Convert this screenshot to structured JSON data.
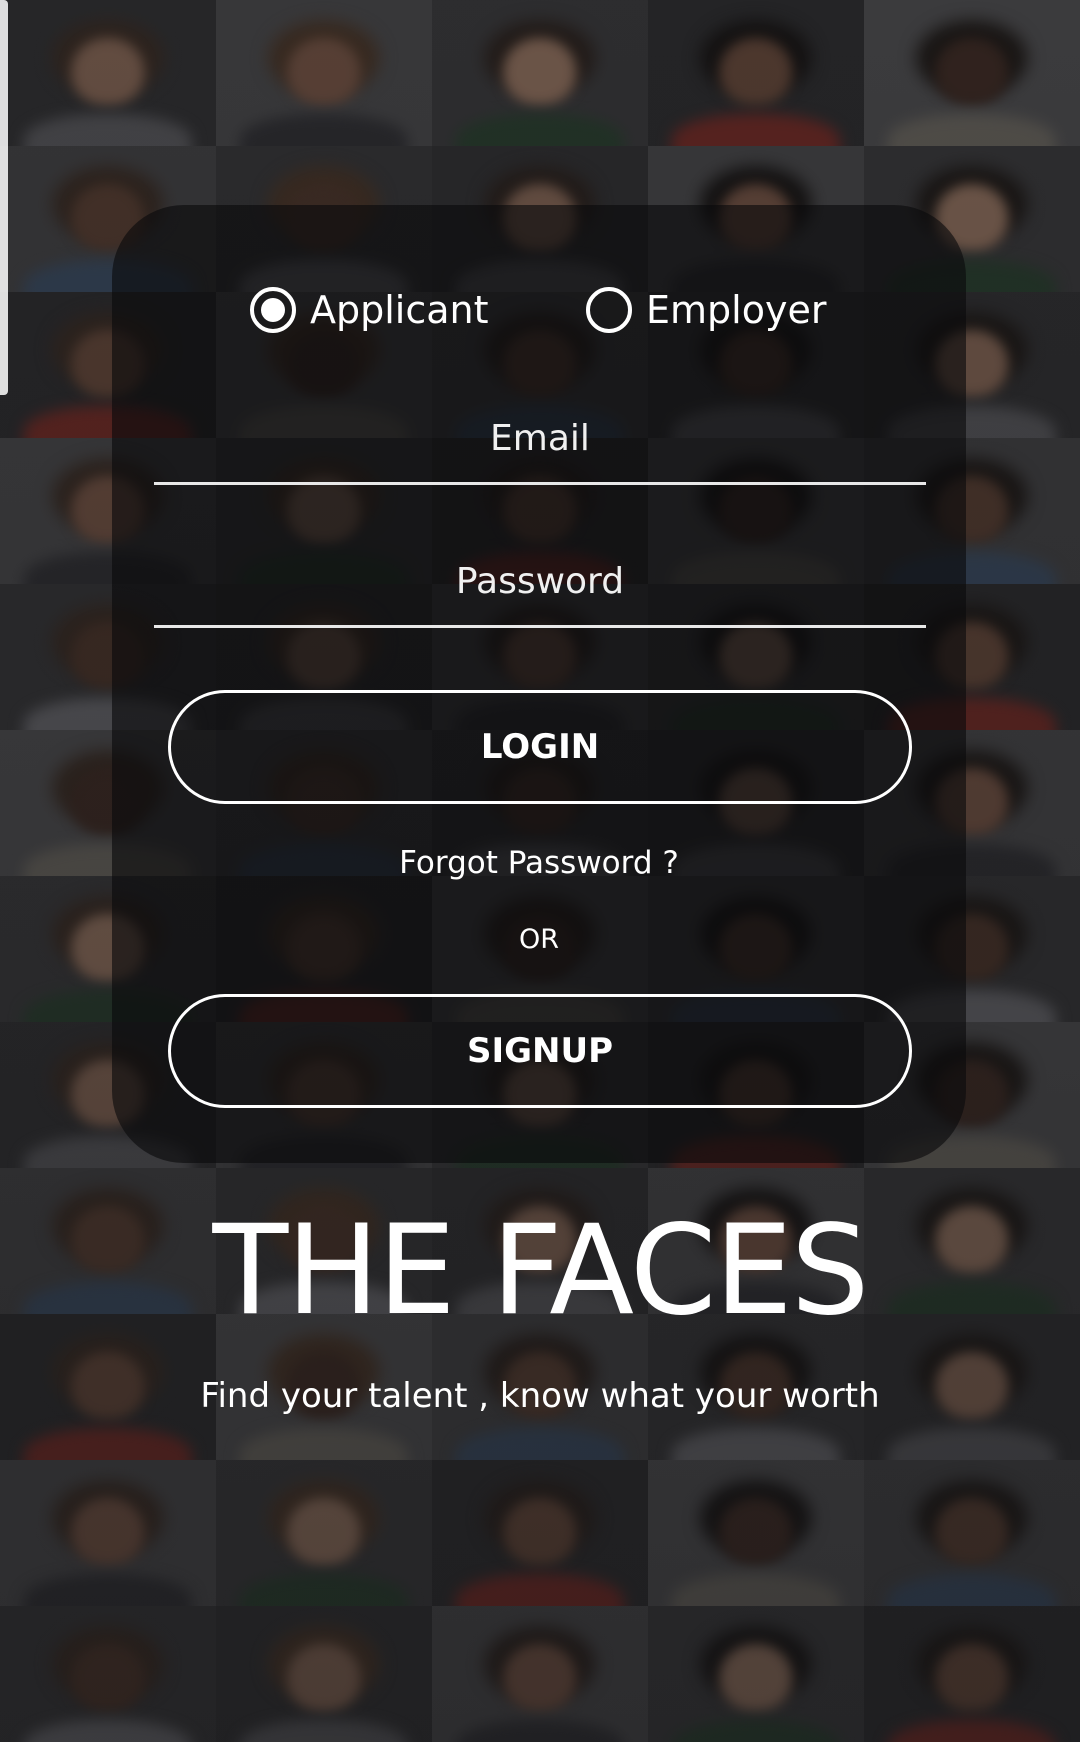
{
  "role_selector": {
    "applicant_label": "Applicant",
    "employer_label": "Employer",
    "selected": "Applicant"
  },
  "form": {
    "email_placeholder": "Email",
    "password_placeholder": "Password",
    "login_label": "LOGIN",
    "forgot_label": "Forgot Password ?",
    "or_label": "OR",
    "signup_label": "SIGNUP"
  },
  "brand": {
    "title": "THE FACES",
    "tagline": "Find your talent , know what your worth"
  },
  "colors": {
    "card_overlay": "#0a0a0c",
    "text": "#ffffff",
    "background": "#2a2a2b"
  }
}
